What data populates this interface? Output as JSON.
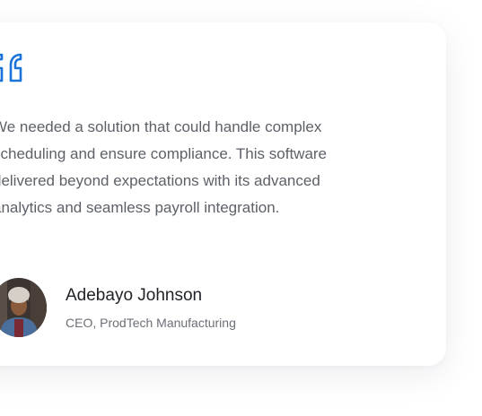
{
  "testimonial": {
    "quote_icon": "quote-open-icon",
    "text": "We needed a solution that could handle complex scheduling and ensure compliance. This software delivered beyond expectations with its advanced analytics and seamless payroll integration.",
    "author": {
      "name": "Adebayo Johnson",
      "role": "CEO, ProdTech Manufacturing",
      "avatar_icon": "avatar"
    }
  },
  "colors": {
    "accent": "#1a73d9",
    "text": "#5d6168",
    "name": "#1e2126"
  }
}
